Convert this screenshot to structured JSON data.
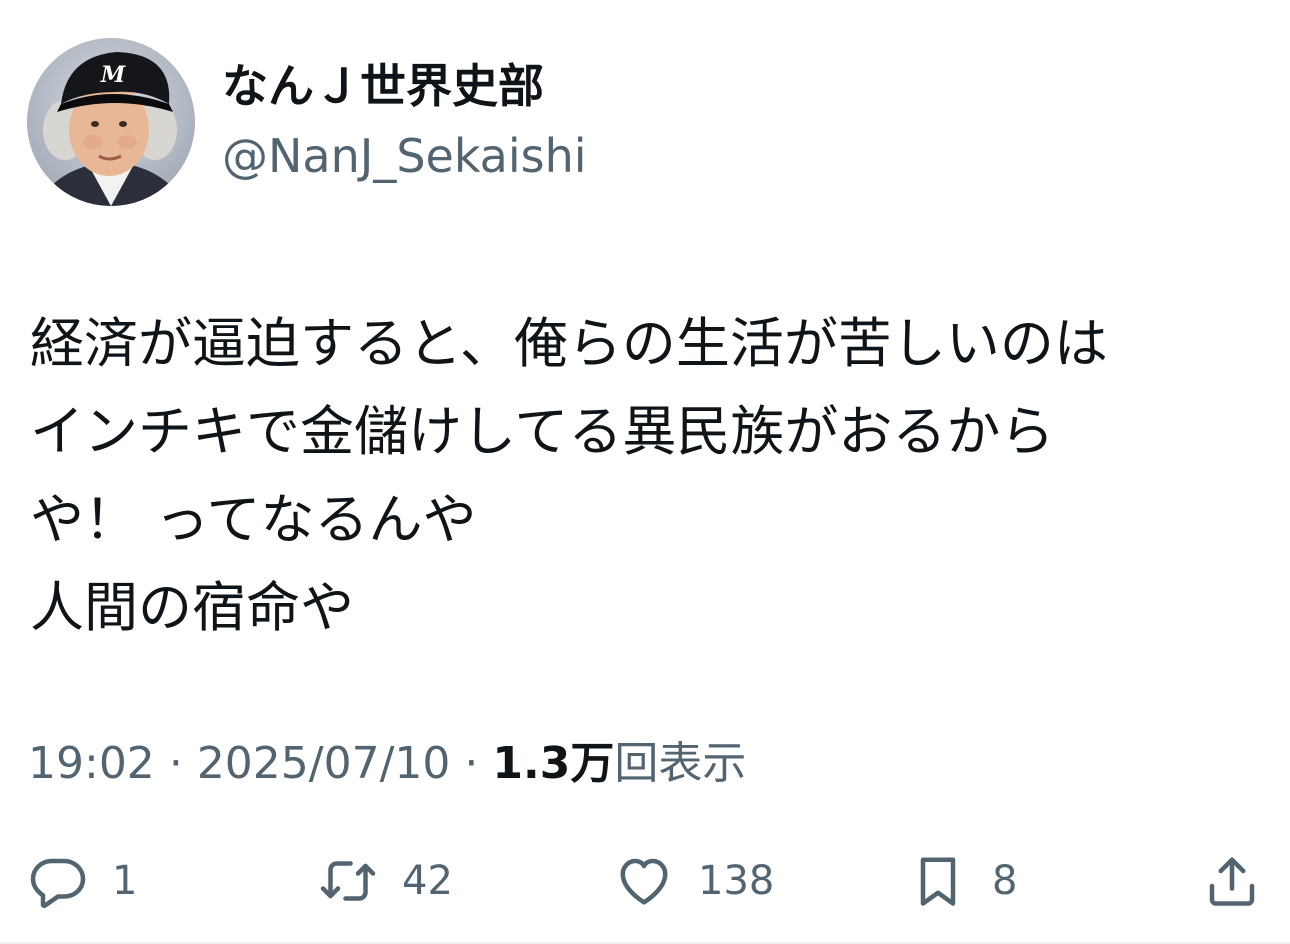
{
  "author": {
    "display_name": "なんＪ世界史部",
    "handle": "@NanJ_Sekaishi",
    "avatar_badge": "M"
  },
  "tweet": {
    "lines": [
      "経済が逼迫すると、俺らの生活が苦しいのは",
      "インチキで金儲けしてる異民族がおるから",
      "や！ ってなるんや",
      "人間の宿命や"
    ]
  },
  "meta": {
    "time": "19:02",
    "separator": "·",
    "date": "2025/07/10",
    "views_count": "1.3万",
    "views_label": "回表示"
  },
  "actions": {
    "reply_count": "1",
    "retweet_count": "42",
    "like_count": "138",
    "bookmark_count": "8"
  },
  "icons": {
    "reply": "reply-icon",
    "retweet": "retweet-icon",
    "like": "heart-icon",
    "bookmark": "bookmark-icon",
    "share": "share-icon"
  },
  "colors": {
    "text_primary": "#0f1419",
    "text_secondary": "#536471"
  }
}
